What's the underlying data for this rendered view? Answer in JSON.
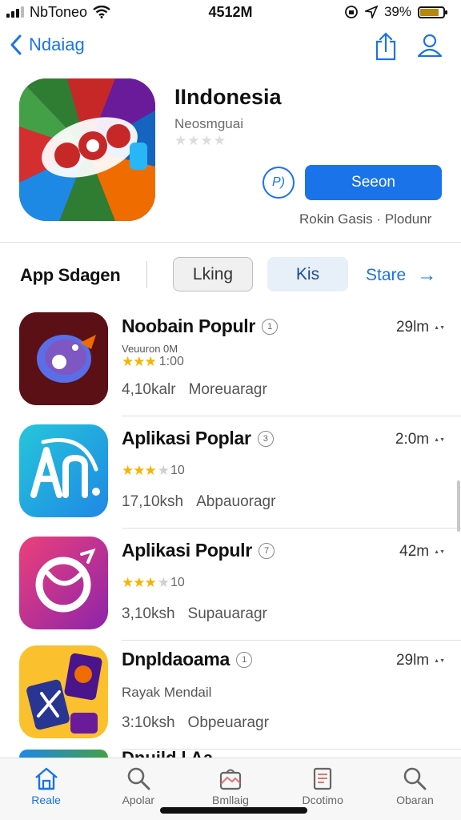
{
  "status_bar": {
    "carrier": "NbToneo",
    "time": "4512M",
    "battery": "39%",
    "battery_level": 0.82
  },
  "nav": {
    "back_label": "Ndaiag"
  },
  "app": {
    "title": "IIndonesia",
    "subtitle": "Neosmguai",
    "stars": "★★★★",
    "circle_button": "P)",
    "get_label": "Seeon",
    "meta": "Rokin Gasis · Plodunr"
  },
  "segment": {
    "title": "App Sdagen",
    "tabs": [
      "Lking",
      "Kis"
    ],
    "link": "Stare",
    "link_arrow": "→"
  },
  "list": [
    {
      "name": "Noobain Populr",
      "info": "1",
      "size": "29lm",
      "sub": "Veuuron 0M",
      "stars_on": "★★★",
      "stars_off": "",
      "rating_text": "1:00",
      "count": "4,10kalr",
      "category": "Moreuaragr"
    },
    {
      "name": "Aplikasi Poplar",
      "info": "3",
      "size": "2:0m",
      "sub": "",
      "stars_on": "★★★",
      "stars_off": "★",
      "rating_text": "10",
      "count": "17,10ksh",
      "category": "Abpauoragr"
    },
    {
      "name": "Aplikasi Populr",
      "info": "7",
      "size": "42m",
      "sub": "",
      "stars_on": "★★★",
      "stars_off": "★",
      "rating_text": "10",
      "count": "3,10ksh",
      "category": "Supauaragr"
    },
    {
      "name": "Dnpldaoama",
      "info": "1",
      "size": "29lm",
      "sub": "Rayak Mendail",
      "stars_on": "",
      "stars_off": "",
      "rating_text": "",
      "count": "3:10ksh",
      "category": "Obpeuaragr"
    }
  ],
  "peek": {
    "title": "Dnuild l Aa"
  },
  "tab_bar": [
    {
      "label": "Reale",
      "icon": "home-icon"
    },
    {
      "label": "Apolar",
      "icon": "search-icon"
    },
    {
      "label": "Bmllaig",
      "icon": "store-icon"
    },
    {
      "label": "Dcotimo",
      "icon": "document-icon"
    },
    {
      "label": "Obaran",
      "icon": "search-icon"
    }
  ],
  "colors": {
    "accent": "#1a73e8",
    "star": "#f4b400"
  }
}
